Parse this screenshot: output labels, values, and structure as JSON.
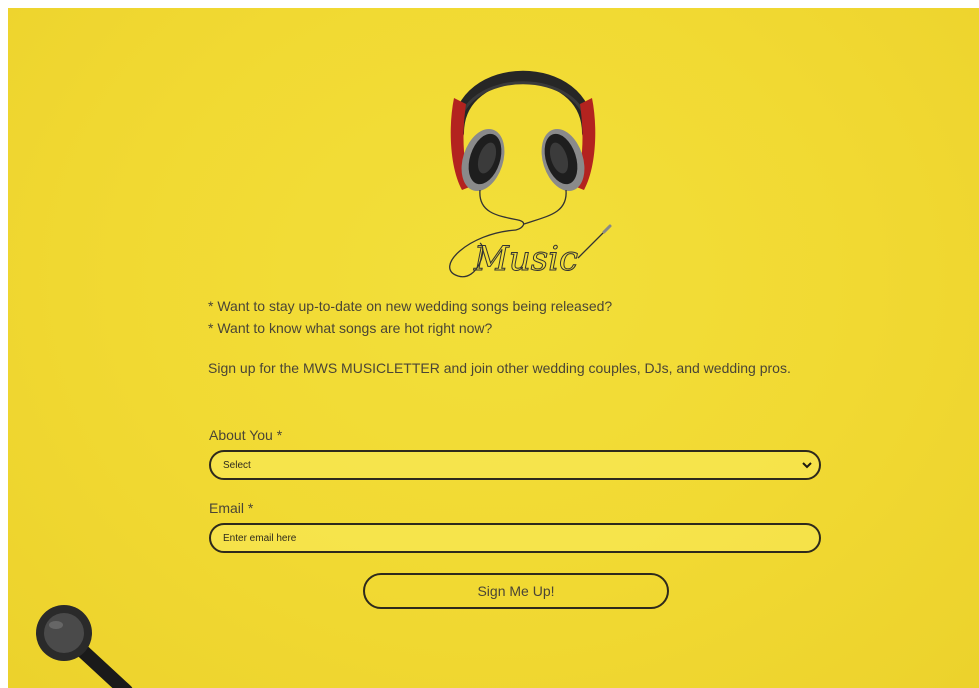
{
  "intro": {
    "line1": "* Want to stay up-to-date on new wedding songs being released?",
    "line2": "* Want to know what songs are hot right now?",
    "signup": "Sign up for the MWS MUSICLETTER and join other wedding couples, DJs, and wedding pros."
  },
  "logo": {
    "script_text": "Music"
  },
  "form": {
    "about_label": "About You *",
    "about_select_value": "Select",
    "email_label": "Email *",
    "email_placeholder": "Enter email here",
    "submit_label": "Sign Me Up!"
  },
  "colors": {
    "background": "#f1d932",
    "border": "#2e2a1c",
    "text": "#4a4536",
    "headphone_red": "#b3231f"
  },
  "icons": {
    "logo": "headphones-music-logo",
    "select_chevron": "chevron-down-icon",
    "decoration": "earbud-icon"
  }
}
